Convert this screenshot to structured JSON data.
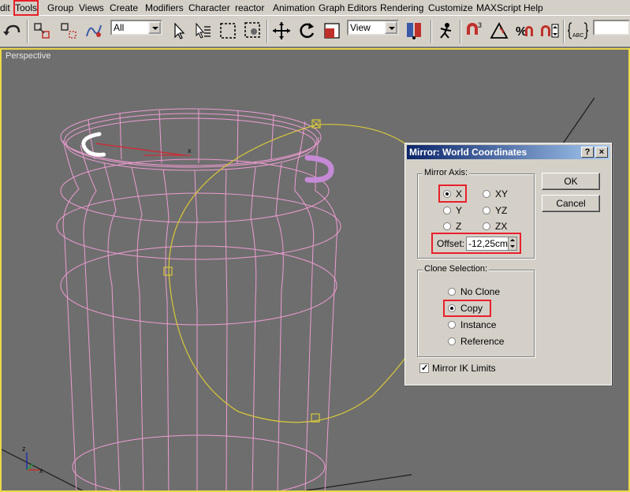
{
  "menu": {
    "items": [
      "dit",
      "Tools",
      "Group",
      "Views",
      "Create",
      "Modifiers",
      "Character",
      "reactor",
      "Animation",
      "Graph Editors",
      "Rendering",
      "Customize",
      "MAXScript",
      "Help"
    ]
  },
  "toolbar": {
    "selection_filter": "All",
    "reference_coord": "View"
  },
  "viewport": {
    "label": "Perspective",
    "axis_x": "x",
    "axis_z": "z",
    "axis_x_small": "x",
    "colors": {
      "wire": "#ee9cd2",
      "circle": "#d8c83a",
      "border": "#e8d94a"
    }
  },
  "dialog": {
    "title": "Mirror: World Coordinates",
    "help_btn": "?",
    "close_btn": "×",
    "mirror_axis": {
      "label": "Mirror Axis:",
      "options": [
        "X",
        "Y",
        "Z",
        "XY",
        "YZ",
        "ZX"
      ],
      "selected": "X",
      "offset_label": "Offset:",
      "offset_value": "-12,25cm"
    },
    "clone_selection": {
      "label": "Clone Selection:",
      "options": [
        "No Clone",
        "Copy",
        "Instance",
        "Reference"
      ],
      "selected": "Copy"
    },
    "mirror_ik_label": "Mirror IK Limits",
    "mirror_ik_checked": true,
    "ok_label": "OK",
    "cancel_label": "Cancel"
  }
}
